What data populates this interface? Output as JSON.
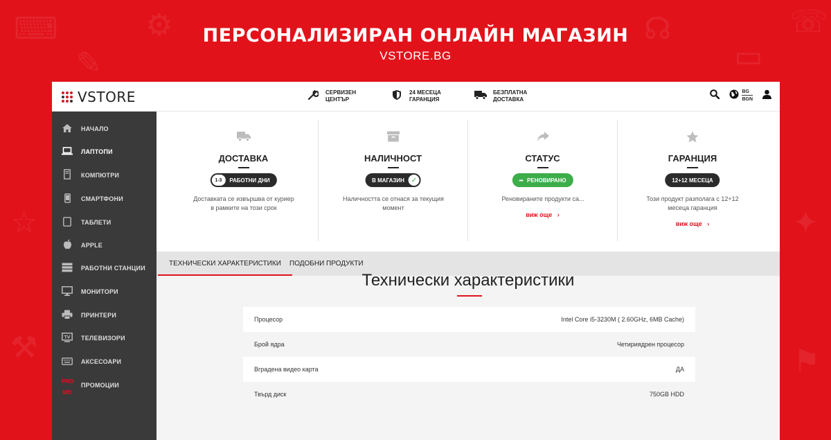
{
  "hero": {
    "title": "ПЕРСОНАЛИЗИРАН ОНЛАЙН МАГАЗИН",
    "subtitle": "VSTORE.BG"
  },
  "brand": {
    "logo_text": "VSTORE",
    "accent": "#e2121b"
  },
  "header": {
    "features": [
      {
        "icon": "wrench-icon",
        "line1": "СЕРВИЗЕН",
        "line2": "ЦЕНТЪР"
      },
      {
        "icon": "shield-icon",
        "line1": "24 МЕСЕЦА",
        "line2": "ГАРАНЦИЯ"
      },
      {
        "icon": "truck-icon",
        "line1": "БЕЗПЛАТНА",
        "line2": "ДОСТАВКА"
      }
    ],
    "lang": {
      "language": "BG",
      "currency": "BGN"
    }
  },
  "sidebar": {
    "items": [
      {
        "label": "НАЧАЛО",
        "icon": "home-icon"
      },
      {
        "label": "ЛАПТОПИ",
        "icon": "laptop-icon",
        "active": true
      },
      {
        "label": "КОМПЮТРИ",
        "icon": "desktop-tower-icon"
      },
      {
        "label": "СМАРТФОНИ",
        "icon": "smartphone-icon"
      },
      {
        "label": "ТАБЛЕТИ",
        "icon": "tablet-icon"
      },
      {
        "label": "APPLE",
        "icon": "apple-icon"
      },
      {
        "label": "РАБОТНИ СТАНЦИИ",
        "icon": "server-icon"
      },
      {
        "label": "МОНИТОРИ",
        "icon": "monitor-icon"
      },
      {
        "label": "ПРИНТЕРИ",
        "icon": "printer-icon"
      },
      {
        "label": "ТЕЛЕВИЗОРИ",
        "icon": "tv-icon"
      },
      {
        "label": "АКСЕСОАРИ",
        "icon": "keyboard-icon"
      },
      {
        "label": "ПРОМОЦИИ",
        "icon": "promo-icon",
        "badge_line1": "PRO",
        "badge_line2": "MO"
      }
    ]
  },
  "cards": [
    {
      "icon": "truck-icon",
      "title": "ДОСТАВКА",
      "pill_num": "1-3",
      "pill_text": "РАБОТНИ ДНИ",
      "desc": "Доставката се извършва от куриер в рамките на този срок",
      "more": ""
    },
    {
      "icon": "box-icon",
      "title": "НАЛИЧНОСТ",
      "pill_text": "В МАГАЗИН",
      "pill_check": "✓",
      "desc": "Наличността се отнася за текущия момент",
      "more": ""
    },
    {
      "icon": "share-arrow-icon",
      "title": "СТАТУС",
      "pill_text": "РЕНОВИРАНО",
      "pill_arrow": "➦",
      "desc": "Реновираните продукти са...",
      "more": "виж още"
    },
    {
      "icon": "star-icon",
      "title": "ГАРАНЦИЯ",
      "pill_text": "12+12 МЕСЕЦА",
      "desc": "Този продукт разполага с 12+12 месеца гаранция",
      "more": "виж още"
    }
  ],
  "more_chevron": "›",
  "tabs": [
    {
      "label": "ТЕХНИЧЕСКИ ХАРАКТЕРИСТИКИ",
      "active": true
    },
    {
      "label": "ПОДОБНИ ПРОДУКТИ"
    }
  ],
  "specs": {
    "title": "Технически характеристики",
    "rows": [
      {
        "label": "Процесор",
        "value": "Intel Core i5-3230M ( 2.60GHz, 6MB Cache)"
      },
      {
        "label": "Брой ядра",
        "value": "Четириядрен процесор"
      },
      {
        "label": "Вградена видео карта",
        "value": "ДА"
      },
      {
        "label": "Твърд диск",
        "value": "750GB HDD"
      }
    ]
  }
}
